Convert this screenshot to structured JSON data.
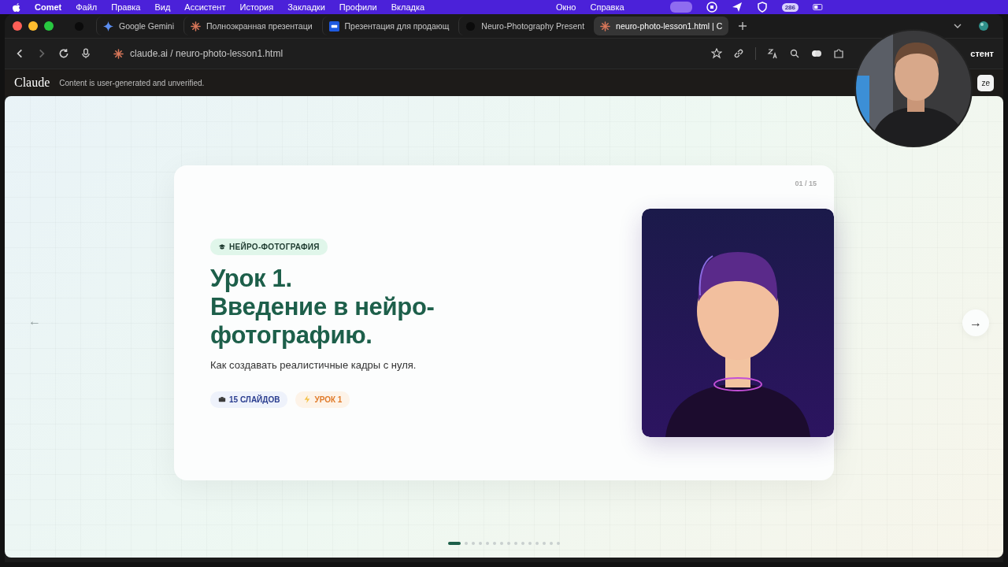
{
  "menu_bar": {
    "app": "Comet",
    "items": [
      "Файл",
      "Правка",
      "Вид",
      "Ассистент",
      "История",
      "Закладки",
      "Профили",
      "Вкладка"
    ],
    "right_items": [
      "Окно",
      "Справка"
    ],
    "badge": "286"
  },
  "tabs": [
    {
      "kind": "pinned",
      "selected": false
    },
    {
      "kind": "gemini",
      "title": "Google Gemini",
      "selected": false
    },
    {
      "kind": "claude",
      "title": "Полноэкранная презентаци",
      "selected": false
    },
    {
      "kind": "behance",
      "title": "Презентация для продающ",
      "selected": false
    },
    {
      "kind": "dark",
      "title": "Neuro-Photography Present",
      "selected": false
    },
    {
      "kind": "claude",
      "title": "neuro-photo-lesson1.html | C",
      "selected": true
    }
  ],
  "address_bar": {
    "url": "claude.ai / neuro-photo-lesson1.html",
    "assistant_label": "стент"
  },
  "app_bar": {
    "logo": "Claude",
    "notice": "Content is user-generated and unverified.",
    "button": "ze"
  },
  "slide": {
    "counter": "01 / 15",
    "tag": "НЕЙРО-ФОТОГРАФИЯ",
    "title": "Урок 1.\nВведение в нейро-\nфотографию.",
    "subtitle": "Как создавать реалистичные кадры с нуля.",
    "chips": [
      {
        "kind": "slides",
        "label": "15 СЛАЙДОВ"
      },
      {
        "kind": "lesson",
        "label": "УРОК 1"
      }
    ]
  },
  "nav": {
    "prev": "←",
    "next": "→"
  },
  "dots": [
    {
      "selected": true
    },
    {
      "selected": false
    },
    {
      "selected": false
    },
    {
      "selected": false
    },
    {
      "selected": false
    },
    {
      "selected": false
    },
    {
      "selected": false
    },
    {
      "selected": false
    },
    {
      "selected": false
    },
    {
      "selected": false
    },
    {
      "selected": false
    },
    {
      "selected": false
    },
    {
      "selected": false
    },
    {
      "selected": false
    },
    {
      "selected": false
    }
  ]
}
